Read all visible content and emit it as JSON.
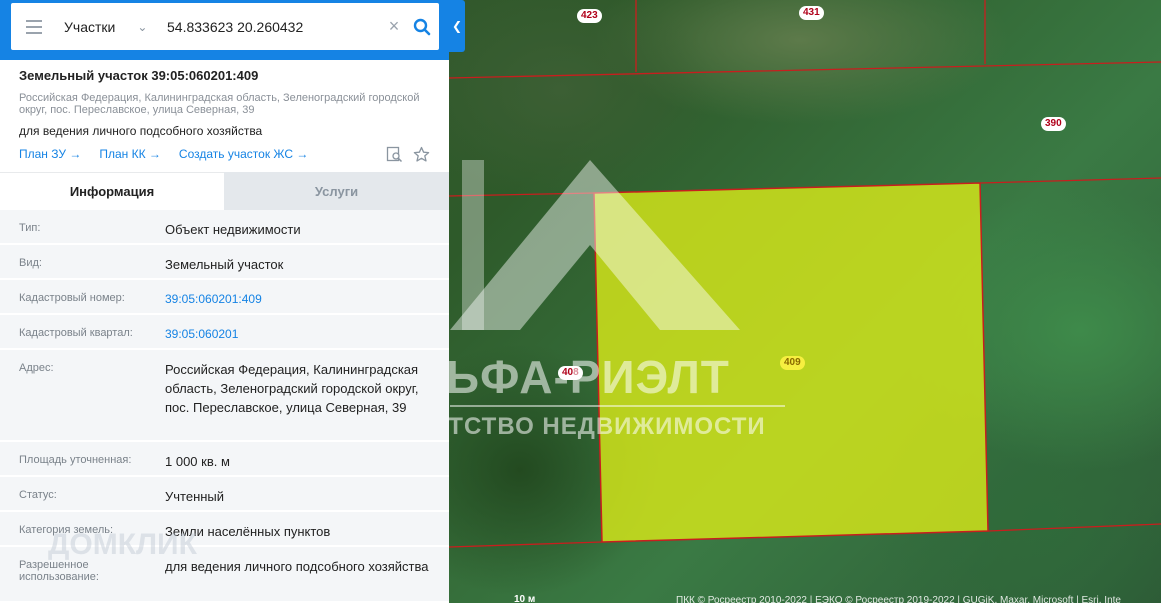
{
  "search": {
    "mode": "Участки",
    "query": "54.833623 20.260432"
  },
  "object": {
    "title": "Земельный участок 39:05:060201:409",
    "address": "Российская Федерация, Калининградская область, Зеленоградский городской округ, пос. Переславское, улица Северная, 39",
    "purpose": "для ведения личного подсобного хозяйства",
    "links": [
      "План ЗУ →",
      "План КК →",
      "Создать участок ЖС →"
    ]
  },
  "tabs": [
    {
      "label": "Информация",
      "active": true
    },
    {
      "label": "Услуги",
      "active": false
    }
  ],
  "rows": [
    {
      "label": "Тип:",
      "value": "Объект недвижимости"
    },
    {
      "label": "Вид:",
      "value": "Земельный участок"
    },
    {
      "label": "Кадастровый номер:",
      "value": "39:05:060201:409",
      "link": true
    },
    {
      "label": "Кадастровый квартал:",
      "value": "39:05:060201",
      "link": true
    },
    {
      "label": "Адрес:",
      "value": "Российская Федерация, Калининградская область, Зеленоградский городской округ, пос. Переславское, улица Северная, 39"
    },
    {
      "label": "Площадь уточненная:",
      "value": "1 000 кв. м"
    },
    {
      "label": "Статус:",
      "value": "Учтенный"
    },
    {
      "label": "Категория земель:",
      "value": "Земли населённых пунктов"
    },
    {
      "label": "Разрешенное использование:",
      "value": "для ведения личного подсобного хозяйства"
    }
  ],
  "map": {
    "plot_labels": [
      "423",
      "431",
      "390",
      "408",
      "409"
    ],
    "highlight_color": "#d7e81a",
    "boundary_color": "#c81e1e",
    "watermark_main": "АЛЬФА-РИЭЛТ",
    "watermark_sub": "АГЕНТСТВО НЕДВИЖИМОСТИ",
    "watermark_corner": "ДОМКЛИК",
    "scale": "10 м",
    "attribution": "ПКК © Росреестр 2010-2022 | ЕЭКО © Росреестр 2019-2022 | GUGiK, Maxar, Microsoft | Esri, Inte"
  }
}
